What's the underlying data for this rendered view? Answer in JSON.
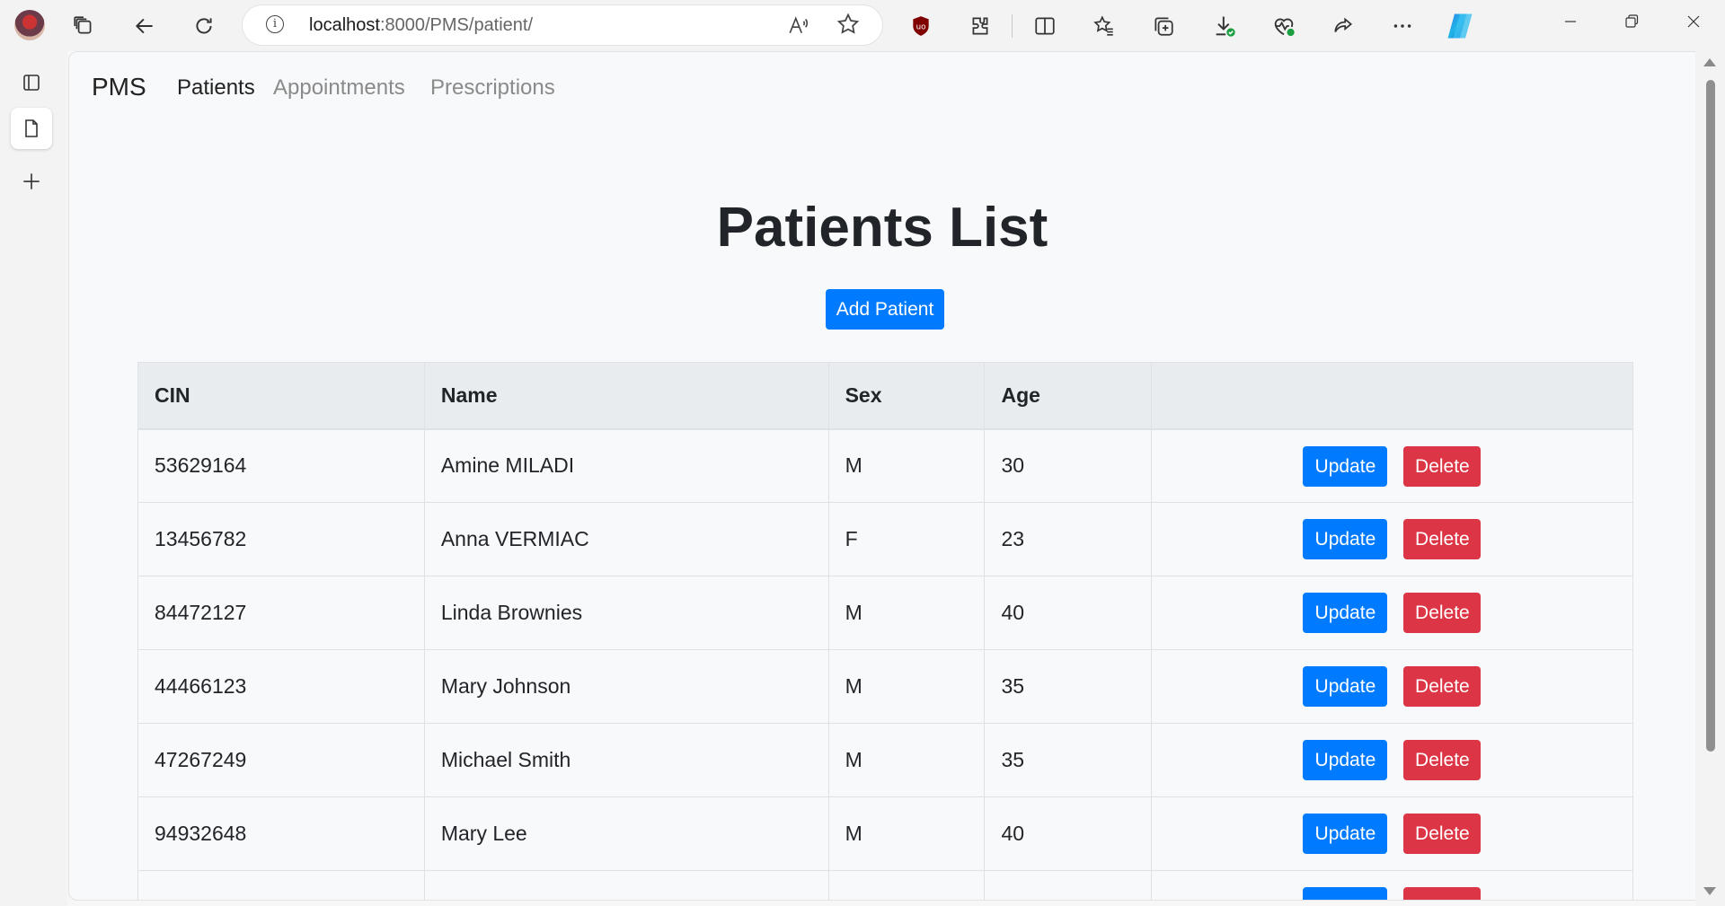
{
  "browser": {
    "url_host": "localhost",
    "url_rest": ":8000/PMS/patient/",
    "icons": [
      "avatar",
      "tabs-icon",
      "back-icon",
      "refresh-icon",
      "info-icon",
      "read-aloud-icon",
      "favorite-star-icon",
      "ublock-icon",
      "extensions-icon",
      "split-screen-icon",
      "favorites-icon",
      "collections-icon",
      "downloads-icon",
      "browser-essentials-icon",
      "share-icon",
      "more-icon",
      "copilot-icon",
      "minimize-icon",
      "restore-icon",
      "close-icon"
    ]
  },
  "navbar": {
    "brand": "PMS",
    "links": [
      {
        "label": "Patients",
        "active": true
      },
      {
        "label": "Appointments",
        "active": false
      },
      {
        "label": "Prescriptions",
        "active": false
      }
    ]
  },
  "main": {
    "title": "Patients List",
    "add_button": "Add Patient",
    "table": {
      "headers": [
        "CIN",
        "Name",
        "Sex",
        "Age",
        ""
      ],
      "rows": [
        {
          "cin": "53629164",
          "name": "Amine MILADI",
          "sex": "M",
          "age": "30"
        },
        {
          "cin": "13456782",
          "name": "Anna VERMIAC",
          "sex": "F",
          "age": "23"
        },
        {
          "cin": "84472127",
          "name": "Linda Brownies",
          "sex": "M",
          "age": "40"
        },
        {
          "cin": "44466123",
          "name": "Mary Johnson",
          "sex": "M",
          "age": "35"
        },
        {
          "cin": "47267249",
          "name": "Michael Smith",
          "sex": "M",
          "age": "35"
        },
        {
          "cin": "94932648",
          "name": "Mary Lee",
          "sex": "M",
          "age": "40"
        }
      ],
      "update_label": "Update",
      "delete_label": "Delete"
    }
  },
  "colors": {
    "primary": "#007bff",
    "danger": "#dc3545",
    "header_bg": "#e9ecef",
    "page_bg": "#f8f9fa"
  }
}
